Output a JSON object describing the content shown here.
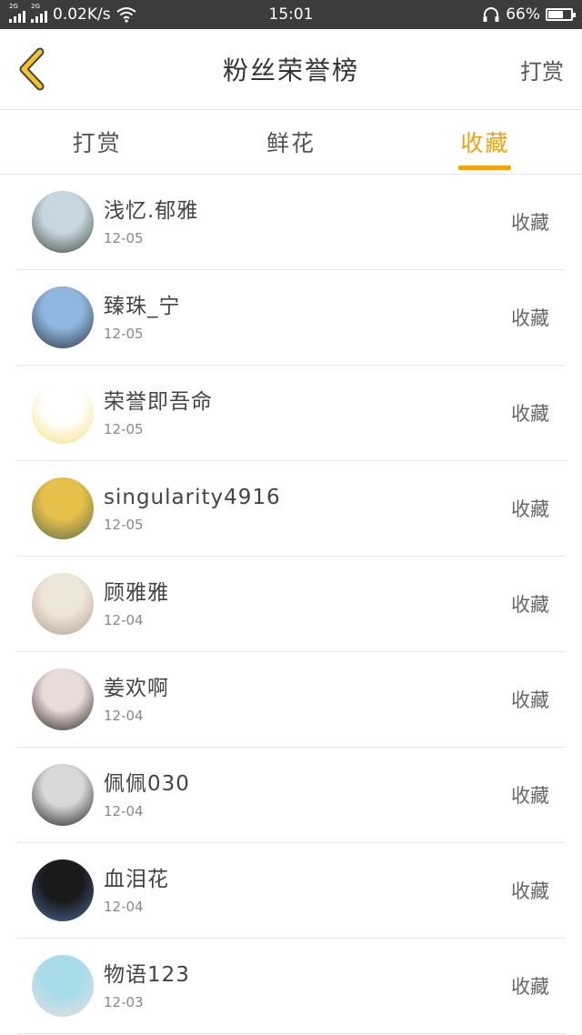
{
  "status_bar": {
    "sim1": "2G",
    "sim2": "2G",
    "speed": "0.02K/s",
    "time": "15:01",
    "battery": "66%",
    "battery_level": 0.66
  },
  "header": {
    "title": "粉丝荣誉榜",
    "action_label": "打赏"
  },
  "tabs": [
    {
      "label": "打赏",
      "active": false
    },
    {
      "label": "鲜花",
      "active": false
    },
    {
      "label": "收藏",
      "active": true
    }
  ],
  "colors": {
    "accent": "#f2a20c",
    "status_bar": "#3c3c3c",
    "back_icon": "#f6c324"
  },
  "rows": [
    {
      "name": "浅忆.郁雅",
      "date": "12-05",
      "action": "收藏",
      "avatar_colors": [
        "#c8d6e0",
        "#3e4a3a"
      ]
    },
    {
      "name": "臻珠_宁",
      "date": "12-05",
      "action": "收藏",
      "avatar_colors": [
        "#8fb6de",
        "#2c3540"
      ]
    },
    {
      "name": "荣誉即吾命",
      "date": "12-05",
      "action": "收藏",
      "avatar_colors": [
        "#ffffff",
        "#f3e27a"
      ]
    },
    {
      "name": "singularity4916",
      "date": "12-05",
      "action": "收藏",
      "avatar_colors": [
        "#e6c04a",
        "#5c6a4e"
      ]
    },
    {
      "name": "顾雅雅",
      "date": "12-04",
      "action": "收藏",
      "avatar_colors": [
        "#efe6da",
        "#b0a18e"
      ]
    },
    {
      "name": "姜欢啊",
      "date": "12-04",
      "action": "收藏",
      "avatar_colors": [
        "#e8dcd8",
        "#2a2222"
      ]
    },
    {
      "name": "佩佩030",
      "date": "12-04",
      "action": "收藏",
      "avatar_colors": [
        "#d8d8d8",
        "#1e1e1e"
      ]
    },
    {
      "name": "血泪花",
      "date": "12-04",
      "action": "收藏",
      "avatar_colors": [
        "#1a1a1a",
        "#4a6a9a"
      ]
    },
    {
      "name": "物语123",
      "date": "12-03",
      "action": "收藏",
      "avatar_colors": [
        "#a8dcea",
        "#e8e0dc"
      ]
    }
  ]
}
